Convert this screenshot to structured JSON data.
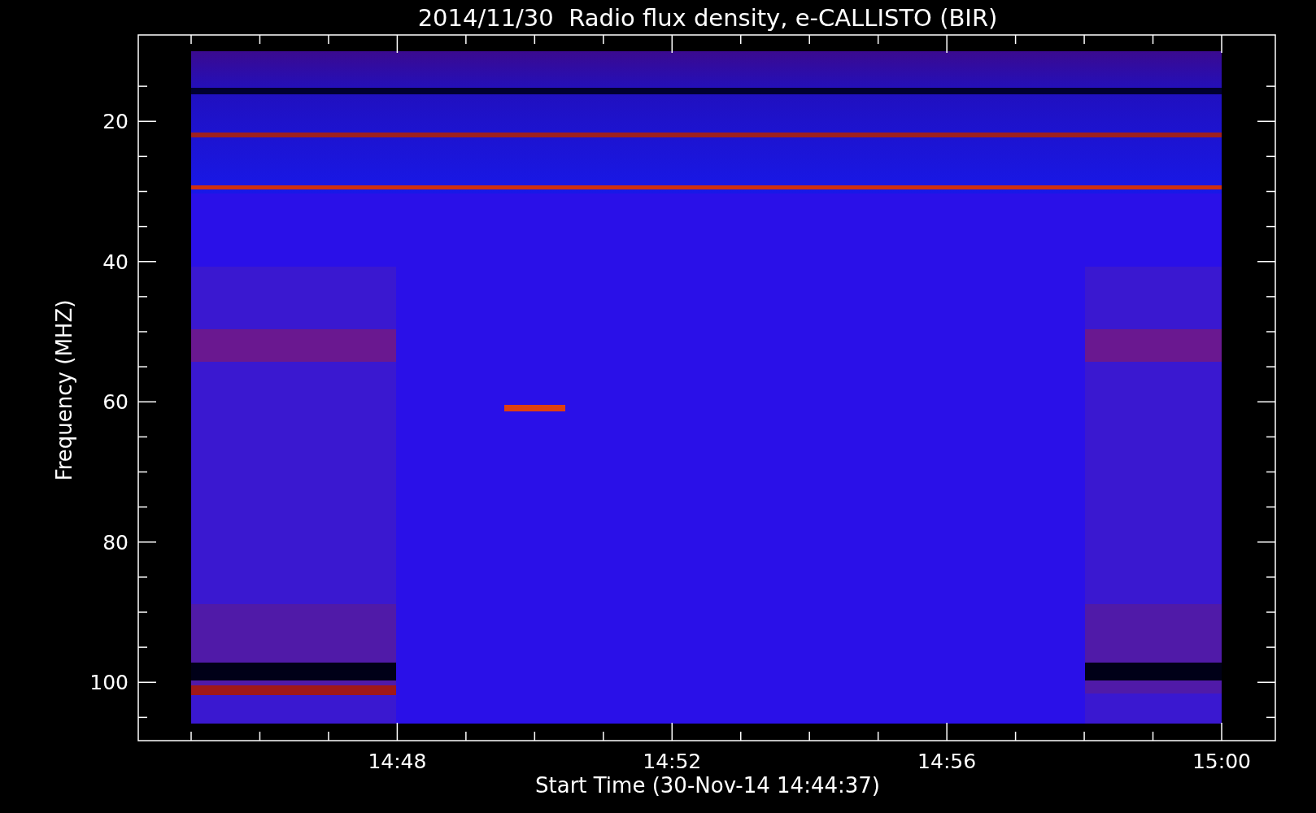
{
  "plot": {
    "title": "2014/11/30  Radio flux density, e-CALLISTO (BIR)",
    "ylabel": "Frequency (MHZ)",
    "xlabel": "Start Time (30-Nov-14 14:44:37)",
    "y_tick_labels": [
      "20",
      "40",
      "60",
      "80",
      "100"
    ],
    "x_tick_labels": [
      "14:48",
      "14:52",
      "14:56",
      "15:00"
    ],
    "image": {
      "kind": "picture"
    }
  }
}
